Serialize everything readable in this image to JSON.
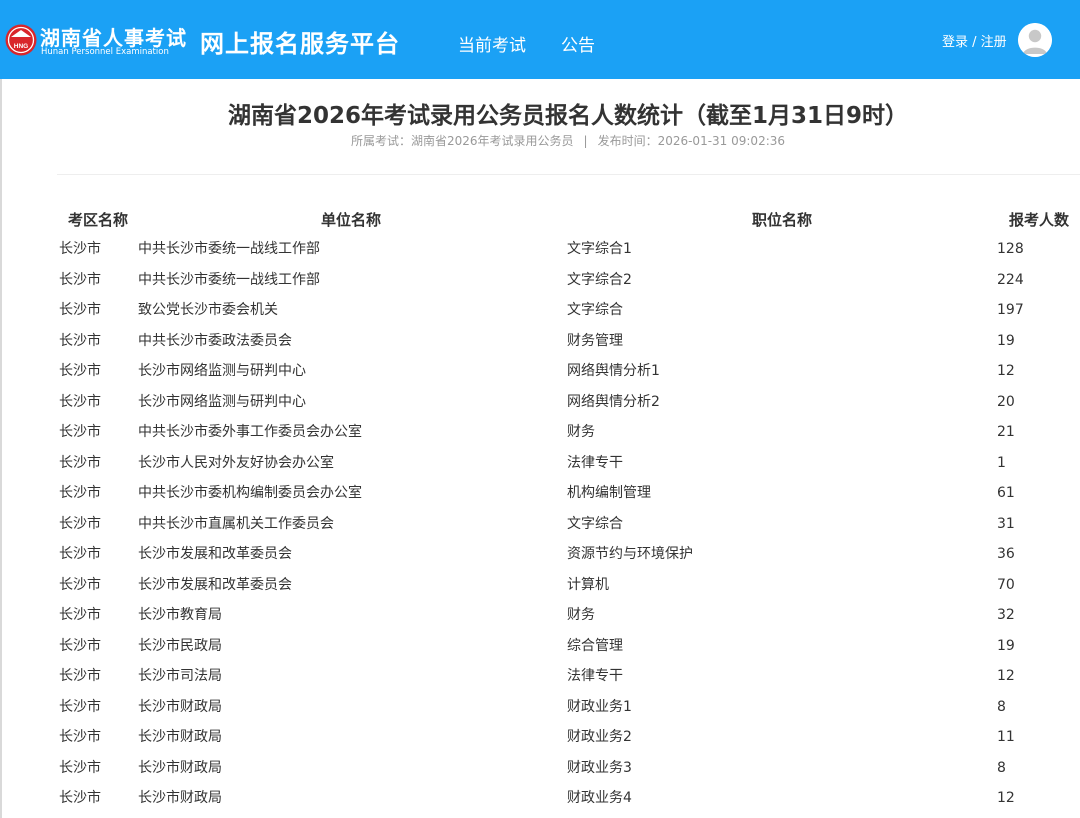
{
  "header": {
    "logo_cn": "湖南省人事考试",
    "logo_en": "Hunan Personnel Examination",
    "logo_badge": "HNG",
    "platform_title": "网上报名服务平台",
    "nav": [
      "当前考试",
      "公告"
    ],
    "auth_label": "登录 / 注册",
    "colors": {
      "bar": "#1ba1f5",
      "logo_red": "#d9262b"
    },
    "icons": {
      "logo": "seal-logo-icon",
      "avatar": "user-avatar-icon"
    }
  },
  "article": {
    "title": "湖南省2026年考试录用公务员报名人数统计（截至1月31日9时）",
    "exam_label": "所属考试：湖南省2026年考试录用公务员",
    "separator": "|",
    "publish_label": "发布时间：2026-01-31 09:02:36"
  },
  "table": {
    "headers": [
      "考区名称",
      "单位名称",
      "职位名称",
      "报考人数"
    ],
    "rows": [
      [
        "长沙市",
        "中共长沙市委统一战线工作部",
        "文字综合1",
        "128"
      ],
      [
        "长沙市",
        "中共长沙市委统一战线工作部",
        "文字综合2",
        "224"
      ],
      [
        "长沙市",
        "致公党长沙市委会机关",
        "文字综合",
        "197"
      ],
      [
        "长沙市",
        "中共长沙市委政法委员会",
        "财务管理",
        "19"
      ],
      [
        "长沙市",
        "长沙市网络监测与研判中心",
        "网络舆情分析1",
        "12"
      ],
      [
        "长沙市",
        "长沙市网络监测与研判中心",
        "网络舆情分析2",
        "20"
      ],
      [
        "长沙市",
        "中共长沙市委外事工作委员会办公室",
        "财务",
        "21"
      ],
      [
        "长沙市",
        "长沙市人民对外友好协会办公室",
        "法律专干",
        "1"
      ],
      [
        "长沙市",
        "中共长沙市委机构编制委员会办公室",
        "机构编制管理",
        "61"
      ],
      [
        "长沙市",
        "中共长沙市直属机关工作委员会",
        "文字综合",
        "31"
      ],
      [
        "长沙市",
        "长沙市发展和改革委员会",
        "资源节约与环境保护",
        "36"
      ],
      [
        "长沙市",
        "长沙市发展和改革委员会",
        "计算机",
        "70"
      ],
      [
        "长沙市",
        "长沙市教育局",
        "财务",
        "32"
      ],
      [
        "长沙市",
        "长沙市民政局",
        "综合管理",
        "19"
      ],
      [
        "长沙市",
        "长沙市司法局",
        "法律专干",
        "12"
      ],
      [
        "长沙市",
        "长沙市财政局",
        "财政业务1",
        "8"
      ],
      [
        "长沙市",
        "长沙市财政局",
        "财政业务2",
        "11"
      ],
      [
        "长沙市",
        "长沙市财政局",
        "财政业务3",
        "8"
      ],
      [
        "长沙市",
        "长沙市财政局",
        "财政业务4",
        "12"
      ]
    ]
  }
}
